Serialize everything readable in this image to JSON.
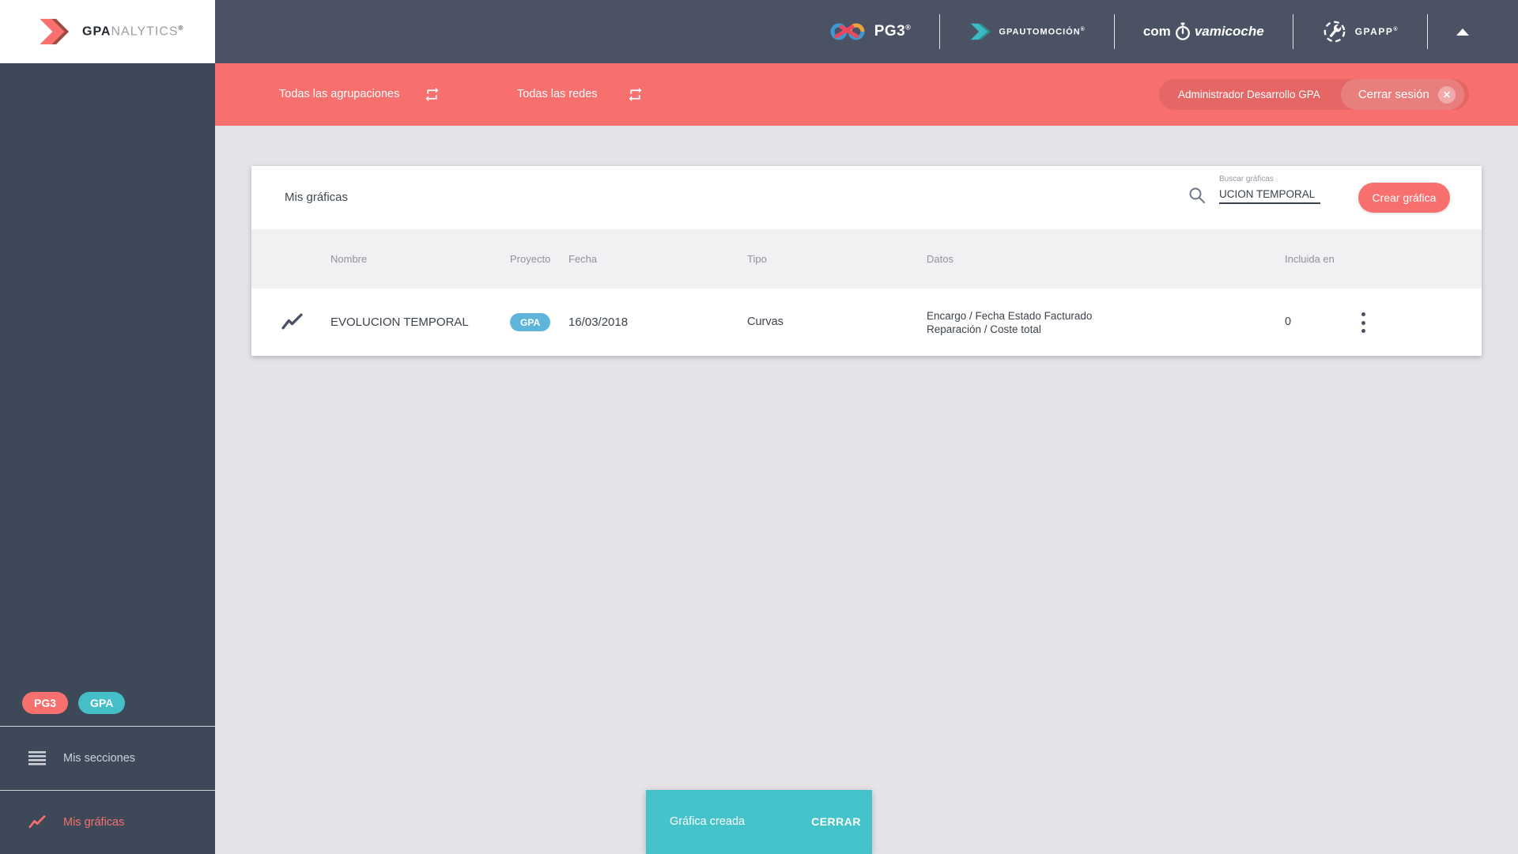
{
  "header": {
    "brand": {
      "bold": "GPA",
      "light": "NALYTICS",
      "reg": "®"
    },
    "logos": {
      "pg3": {
        "label": "PG3",
        "reg": "®"
      },
      "automocion": {
        "label": "GPAUTOMOCIÓN",
        "reg": "®"
      },
      "comvamicoche": {
        "prefix": "com",
        "suffix": "vamicoche"
      },
      "gpapp": {
        "label": "GPAPP",
        "reg": "®"
      }
    }
  },
  "filter_bar": {
    "groupings_label": "Todas las agrupaciones",
    "networks_label": "Todas las redes",
    "user_name": "Administrador Desarrollo GPA",
    "logout_label": "Cerrar sesión",
    "close_glyph": "✕"
  },
  "sidebar": {
    "badges": [
      {
        "label": "PG3"
      },
      {
        "label": "GPA"
      }
    ],
    "items": [
      {
        "label": "Mis secciones"
      },
      {
        "label": "Mis gráficas"
      }
    ]
  },
  "main": {
    "title": "Mis gráficas",
    "search": {
      "label": "Buscar gráficas",
      "value": "UCION TEMPORAL"
    },
    "create_button": "Crear gráfica",
    "table": {
      "columns": [
        "Nombre",
        "Proyecto",
        "Fecha",
        "Tipo",
        "Datos",
        "Incluida en"
      ],
      "rows": [
        {
          "name": "EVOLUCION TEMPORAL",
          "project_badge": "GPA",
          "date": "16/03/2018",
          "type": "Curvas",
          "data_line1": "Encargo / Fecha Estado Facturado",
          "data_line2": "Reparación / Coste total",
          "included_in": "0"
        }
      ]
    }
  },
  "toast": {
    "message": "Gráfica creada",
    "action": "CERRAR"
  },
  "icons": {
    "repeat": "⇄",
    "search": "🔍",
    "menu": "☰",
    "chart-line": "📈",
    "kebab": "⋮",
    "close": "✕",
    "collapse": "▲",
    "stopwatch": "⏱",
    "wrench": "🔧"
  },
  "colors": {
    "coral": "#F8706E",
    "header_slate": "#4A5264",
    "sidebar_slate": "#3D4859",
    "teal": "#45BFC7",
    "toast_teal": "#45C3CA",
    "badge_blue": "#5EB5DA",
    "page_bg": "#E5E3E7",
    "table_head_bg": "#F1F1F4"
  }
}
